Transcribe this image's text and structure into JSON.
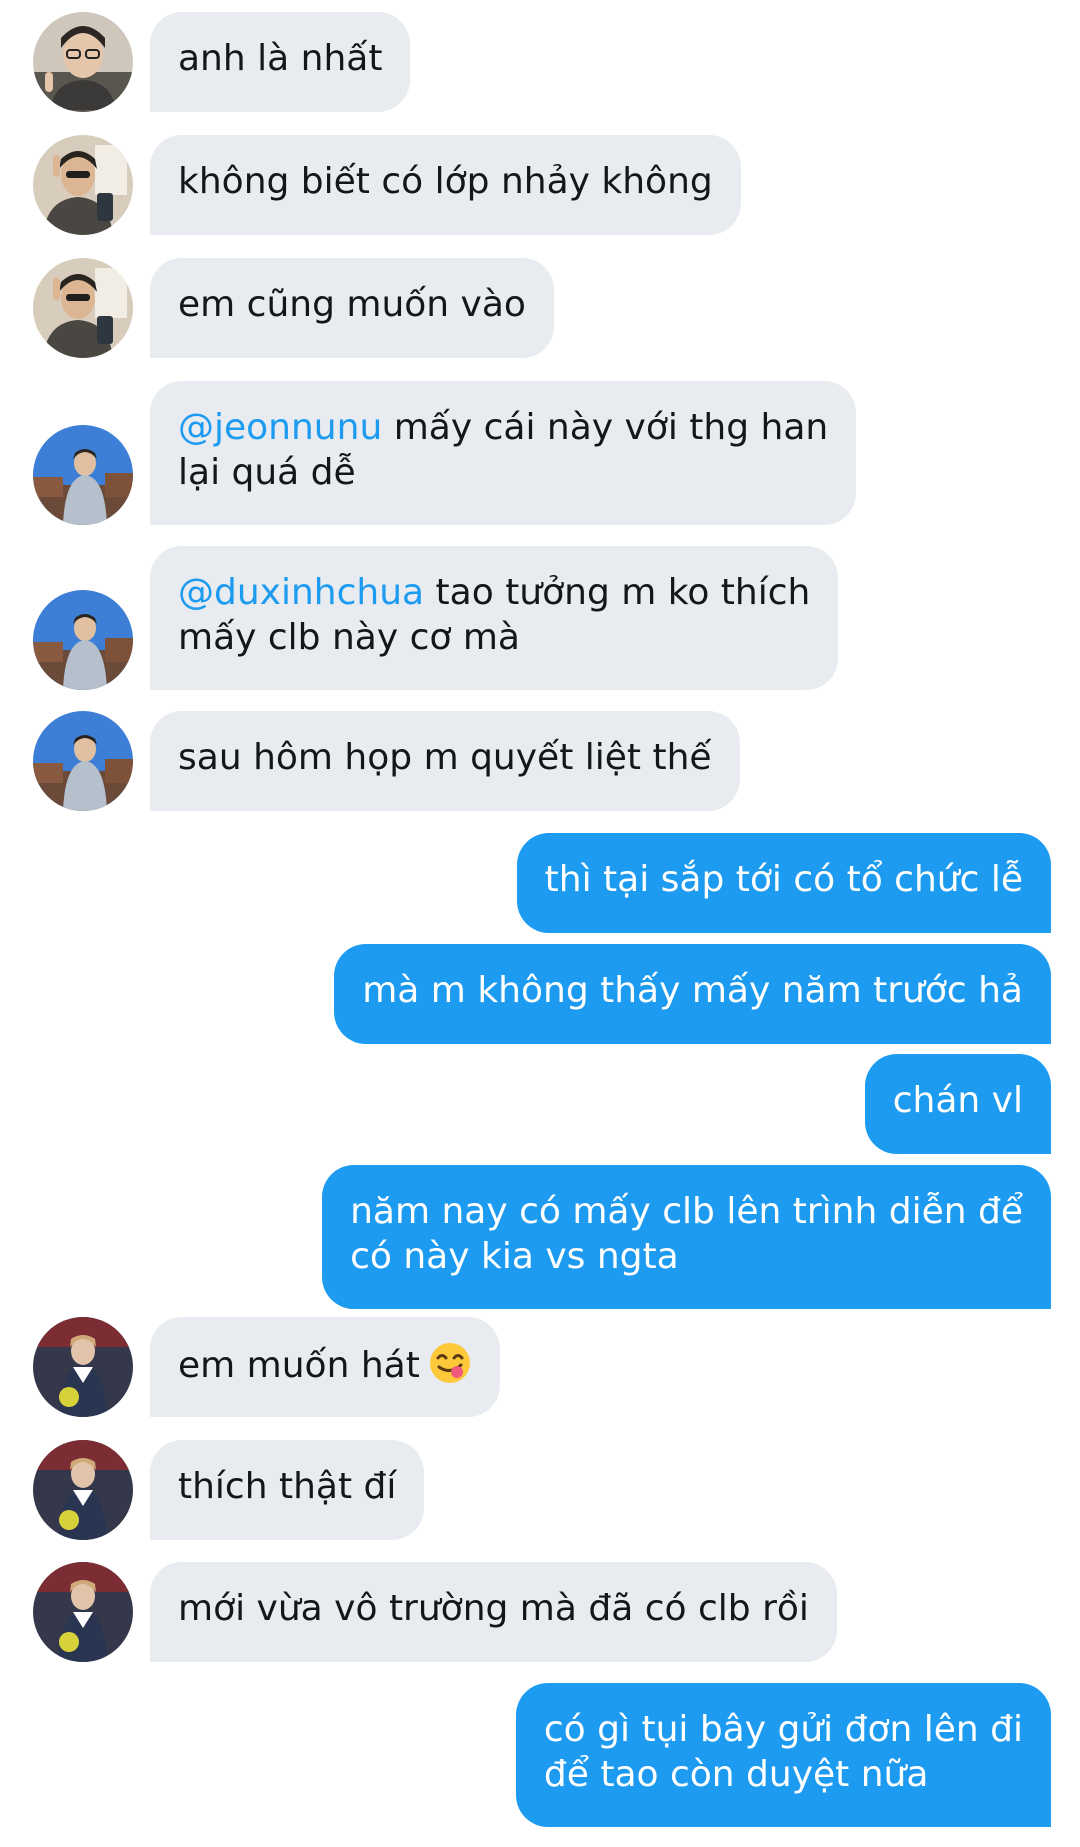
{
  "messages": [
    {
      "side": "in",
      "avatar": "avatar-user-1",
      "text": "anh là nhất"
    },
    {
      "side": "in",
      "avatar": "avatar-user-1",
      "text": "không biết có lớp nhảy không"
    },
    {
      "side": "in",
      "avatar": "avatar-user-1",
      "text": "em cũng muốn vào"
    },
    {
      "side": "in",
      "avatar": "avatar-user-2",
      "mention": "@jeonnunu",
      "text": "mấy cái này với thg han",
      "text2": "lại quá dễ"
    },
    {
      "side": "in",
      "avatar": "avatar-user-2",
      "mention": "@duxinhchua",
      "text": "tao tưởng m ko thích",
      "text2": "mấy clb này cơ mà"
    },
    {
      "side": "in",
      "avatar": "avatar-user-2",
      "text": "sau hôm họp m quyết liệt thế"
    },
    {
      "side": "out",
      "text": "thì tại sắp tới có tổ chức lễ"
    },
    {
      "side": "out",
      "text": "mà m không thấy mấy năm trước hả"
    },
    {
      "side": "out",
      "text": "chán vl"
    },
    {
      "side": "out",
      "text": "năm nay có mấy clb lên trình diễn để",
      "text2": "có này kia vs ngta"
    },
    {
      "side": "in",
      "avatar": "avatar-user-3",
      "text": "em muốn hát",
      "emoji": "face-savoring-food-emoji"
    },
    {
      "side": "in",
      "avatar": "avatar-user-3",
      "text": "thích thật đí"
    },
    {
      "side": "in",
      "avatar": "avatar-user-3",
      "text": "mới vừa vô trường mà đã có clb rồi"
    },
    {
      "side": "out",
      "text": "có gì tụi bây gửi đơn lên đi",
      "text2": "để tao còn duyệt nữa"
    }
  ],
  "colors": {
    "incoming_bubble": "#e8ebef",
    "outgoing_bubble": "#1d9bf0",
    "mention": "#1d9bf0",
    "text_dark": "#14171a"
  }
}
